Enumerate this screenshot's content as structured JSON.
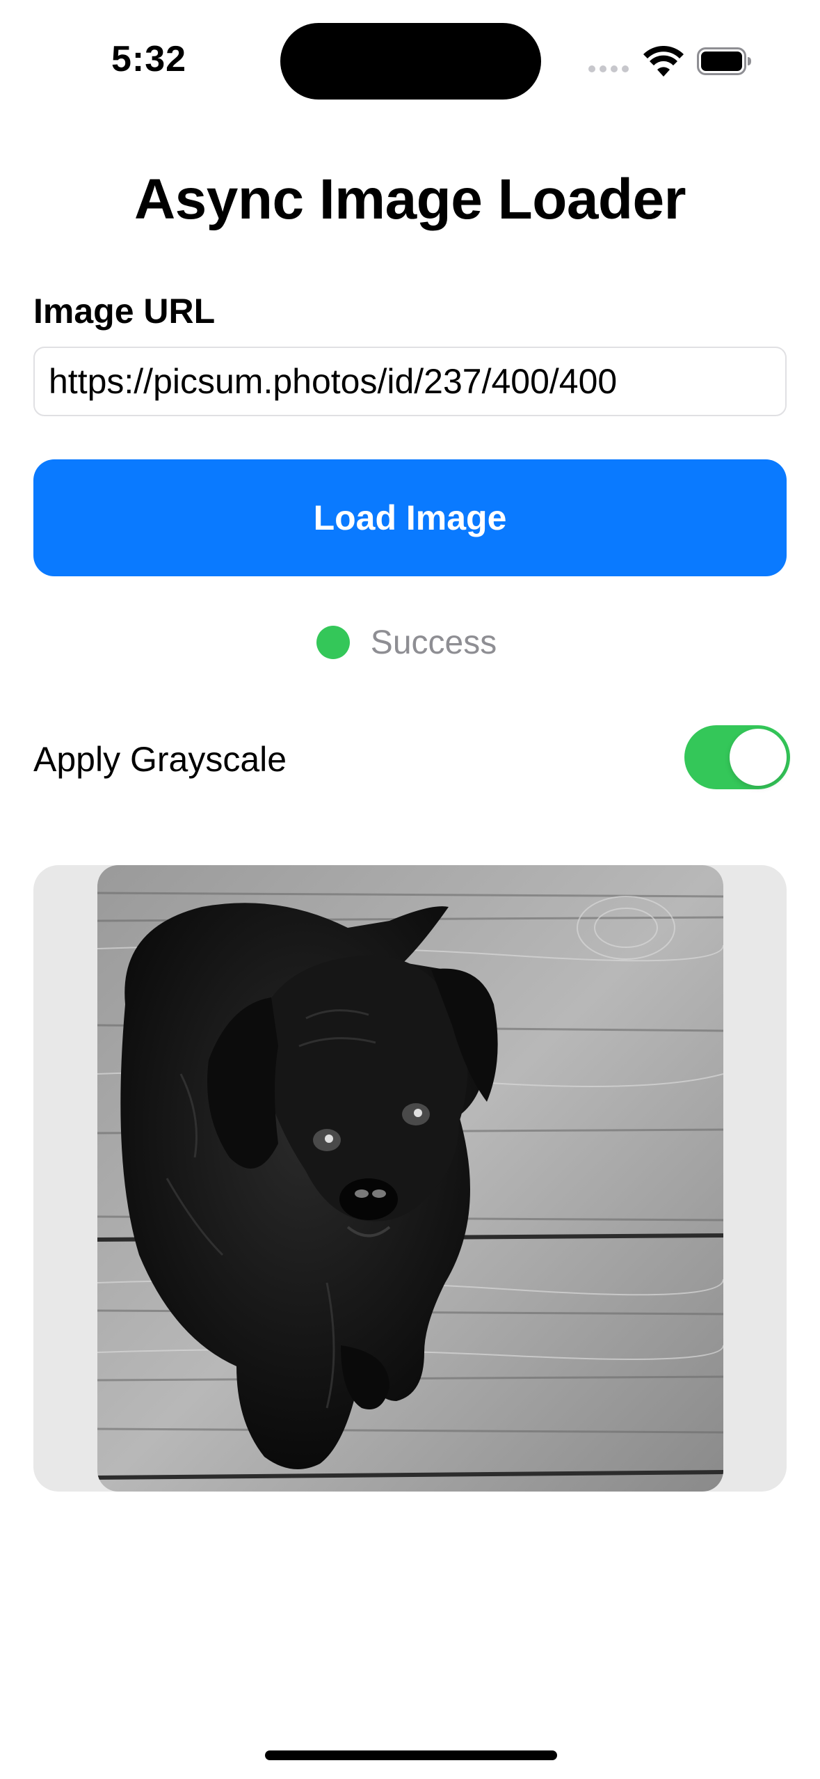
{
  "status_bar": {
    "time": "5:32"
  },
  "title": "Async Image Loader",
  "url_field": {
    "label": "Image URL",
    "value": "https://picsum.photos/id/237/400/400"
  },
  "load_button": {
    "label": "Load Image",
    "color": "#0a7aff"
  },
  "status": {
    "text": "Success",
    "color": "#34c759"
  },
  "grayscale_toggle": {
    "label": "Apply Grayscale",
    "on": true,
    "color": "#34c759"
  },
  "image_preview": {
    "subject": "black-puppy-on-wooden-floor",
    "filter": "grayscale"
  }
}
